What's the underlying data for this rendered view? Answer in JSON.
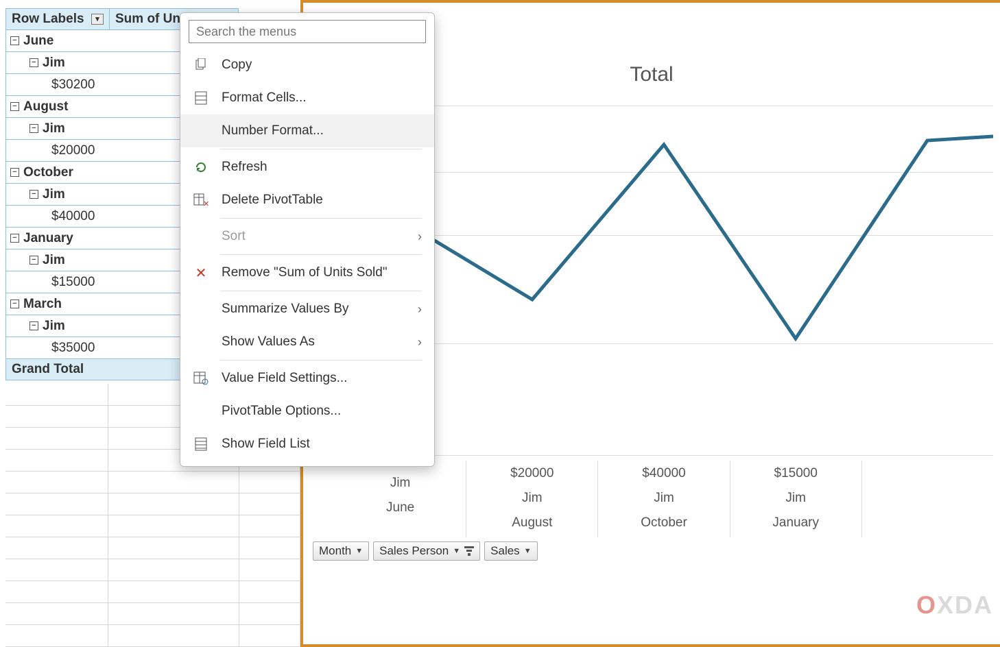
{
  "pivot": {
    "header_rowlabels": "Row Labels",
    "header_sum": "Sum of Un",
    "grand_total": "Grand Total",
    "groups": [
      {
        "month": "June",
        "who": "Jim",
        "value": "$30200"
      },
      {
        "month": "August",
        "who": "Jim",
        "value": "$20000"
      },
      {
        "month": "October",
        "who": "Jim",
        "value": "$40000"
      },
      {
        "month": "January",
        "who": "Jim",
        "value": "$15000"
      },
      {
        "month": "March",
        "who": "Jim",
        "value": "$35000"
      }
    ]
  },
  "context_menu": {
    "search_placeholder": "Search the menus",
    "items": {
      "copy": "Copy",
      "format_cells": "Format Cells...",
      "number_format": "Number Format...",
      "refresh": "Refresh",
      "delete_pivot": "Delete PivotTable",
      "sort": "Sort",
      "remove_field": "Remove \"Sum of Units Sold\"",
      "summarize_by": "Summarize Values By",
      "show_values_as": "Show Values As",
      "value_field_settings": "Value Field Settings...",
      "pivottable_options": "PivotTable Options...",
      "show_field_list": "Show Field List"
    }
  },
  "chart": {
    "title": "Total",
    "axis": [
      {
        "value": "",
        "who": "Jim",
        "month": "June"
      },
      {
        "value": "$20000",
        "who": "Jim",
        "month": "August"
      },
      {
        "value": "$40000",
        "who": "Jim",
        "month": "October"
      },
      {
        "value": "$15000",
        "who": "Jim",
        "month": "January"
      },
      {
        "value": "",
        "who": "",
        "month": ""
      }
    ]
  },
  "pillbar": {
    "month": "Month",
    "sales_person": "Sales Person",
    "sales": "Sales"
  },
  "watermark": {
    "a": "O",
    "b": "XDA"
  },
  "chart_data": {
    "type": "line",
    "title": "Total",
    "series": [
      {
        "name": "Total",
        "values": [
          30200,
          20000,
          40000,
          15000,
          35000
        ]
      }
    ],
    "categories": [
      "June",
      "August",
      "October",
      "January",
      "March"
    ],
    "sales_person": "Jim",
    "ylim": [
      0,
      45000
    ],
    "xlabel": "",
    "ylabel": ""
  }
}
